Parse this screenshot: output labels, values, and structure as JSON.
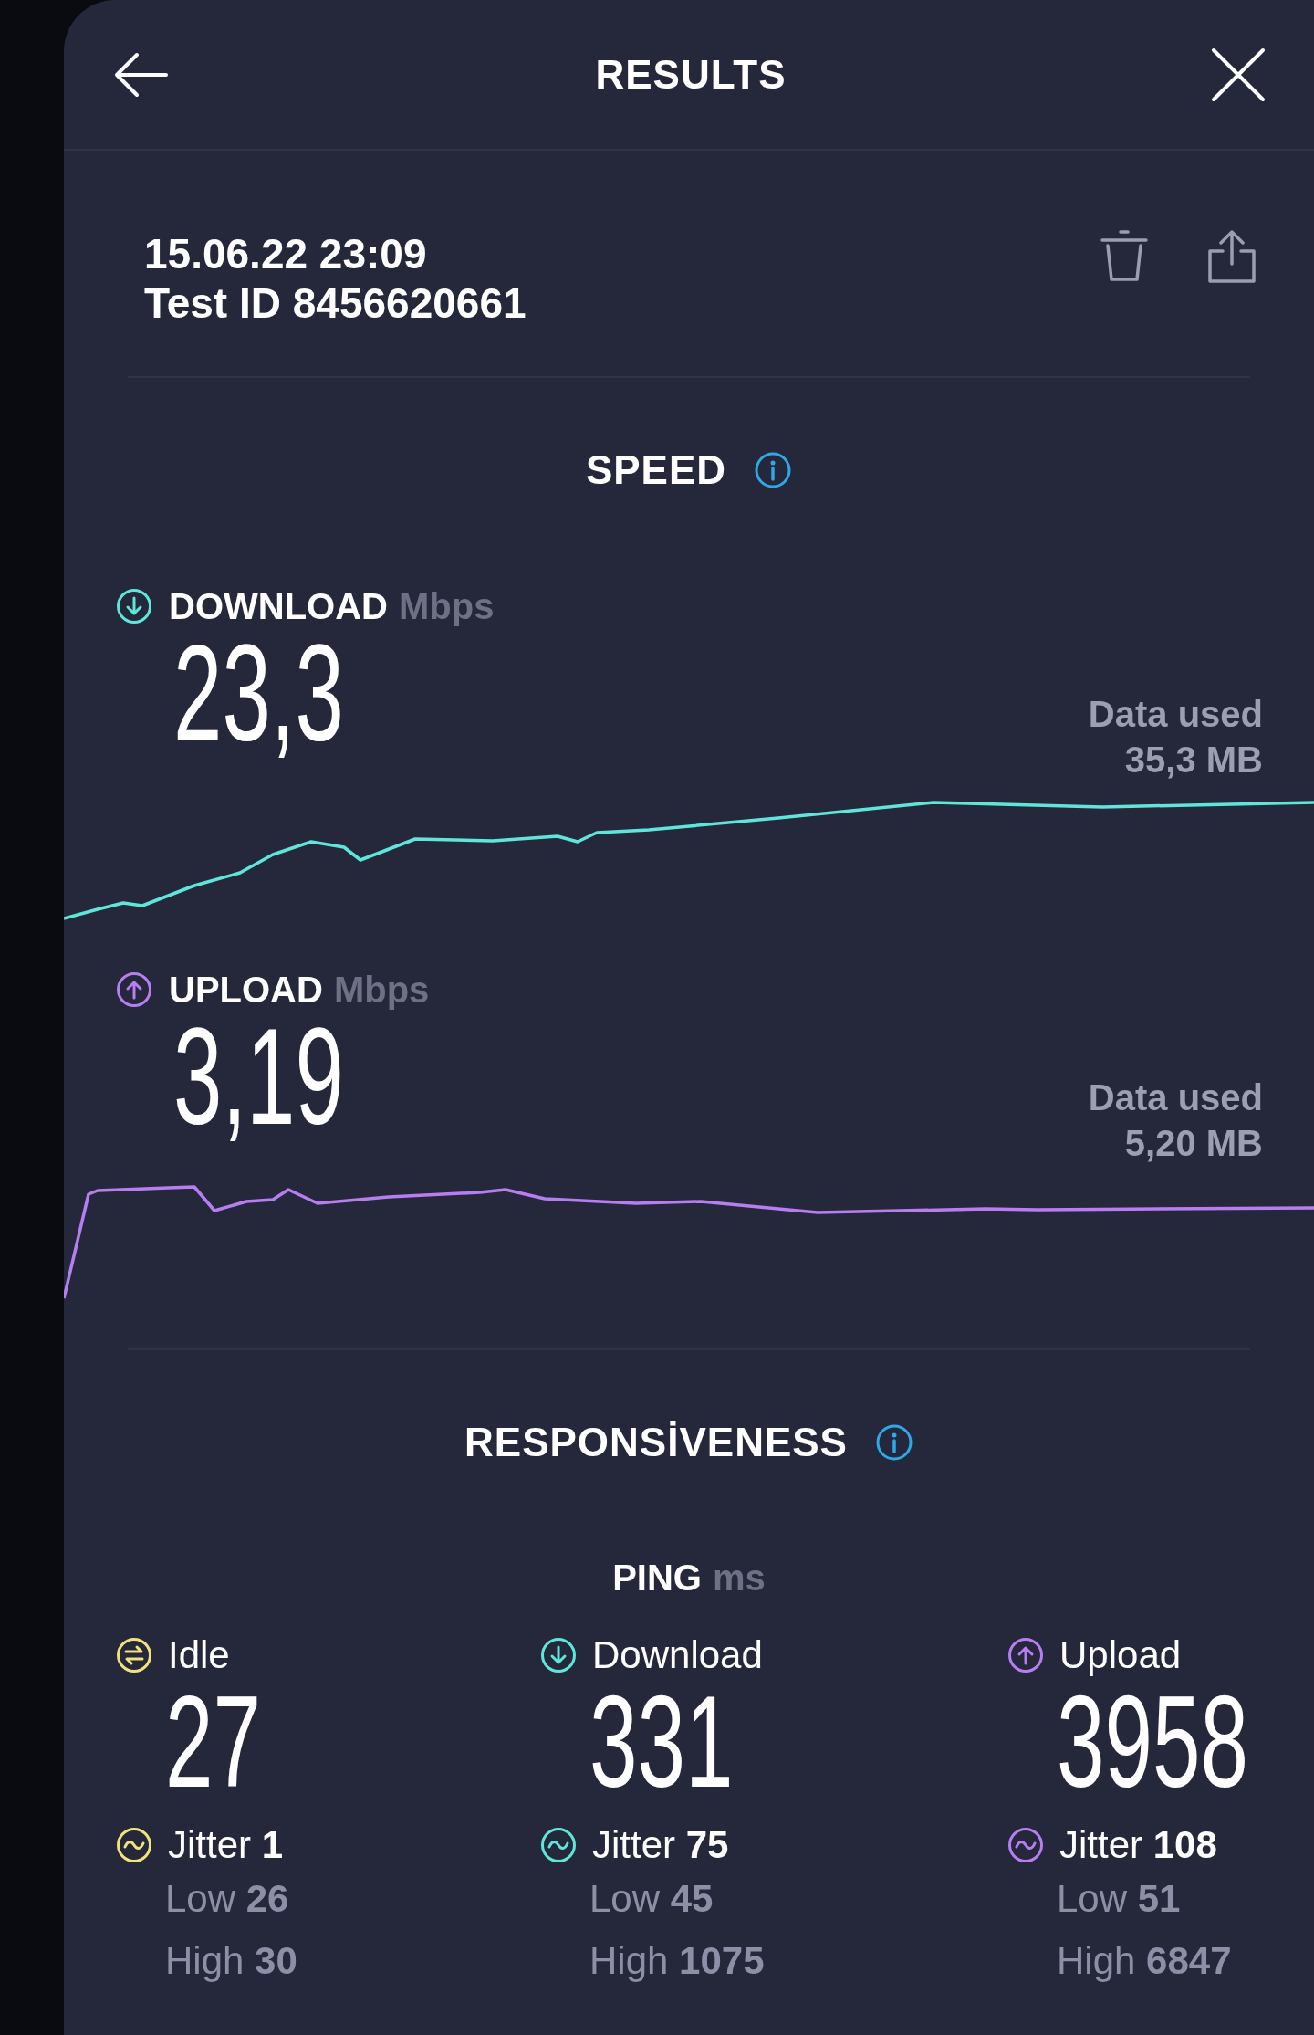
{
  "header": {
    "title": "RESULTS"
  },
  "test": {
    "datetime": "15.06.22 23:09",
    "test_id": "Test ID 8456620661"
  },
  "speed": {
    "title": "SPEED",
    "tests": [
      {
        "kind": "download",
        "label": "DOWNLOAD",
        "unit": "Mbps",
        "value": "23,3",
        "data_used_label": "Data used",
        "data_used": "35,3 MB",
        "color": "#5fe6da"
      },
      {
        "kind": "upload",
        "label": "UPLOAD",
        "unit": "Mbps",
        "value": "3,19",
        "data_used_label": "Data used",
        "data_used": "5,20 MB",
        "color": "#b77ef2"
      }
    ]
  },
  "responsiveness": {
    "title": "RESPONSİVENESS",
    "ping_label": "PING",
    "ping_unit": "ms",
    "columns": [
      {
        "kind": "idle",
        "label": "Idle",
        "value": "27",
        "jitter": "Jitter **1**",
        "low": "Low **26**",
        "high": "High **30**",
        "color": "#f2e27a"
      },
      {
        "kind": "download",
        "label": "Download",
        "value": "331",
        "jitter": "Jitter **75**",
        "low": "Low **45**",
        "high": "High **1075**",
        "color": "#5fe6da"
      },
      {
        "kind": "upload",
        "label": "Upload",
        "value": "3958",
        "jitter": "Jitter **108**",
        "low": "Low **51**",
        "high": "High **6847**",
        "color": "#b77ef2"
      }
    ]
  }
}
